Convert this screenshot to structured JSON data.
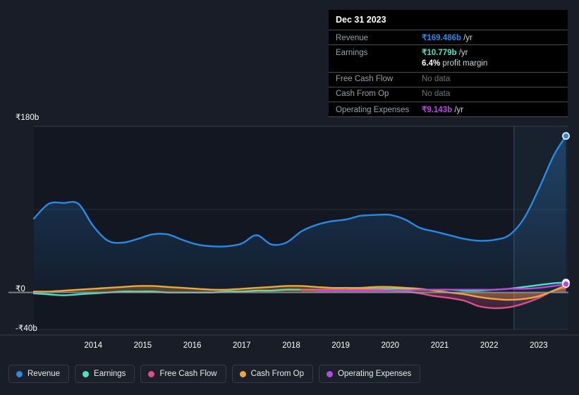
{
  "background": "#181d27",
  "tooltip": {
    "date": "Dec 31 2023",
    "rows": [
      {
        "label": "Revenue",
        "amount": "₹169.486b",
        "unit": " /yr",
        "color": "#2b8ae0",
        "no_data": false
      },
      {
        "label": "Earnings",
        "amount": "₹10.779b",
        "unit": " /yr",
        "color": "#4fe0c0",
        "no_data": false
      },
      {
        "label": "Free Cash Flow",
        "amount": "No data",
        "unit": "",
        "color": "#6d7278",
        "no_data": true
      },
      {
        "label": "Cash From Op",
        "amount": "No data",
        "unit": "",
        "color": "#6d7278",
        "no_data": true
      },
      {
        "label": "Operating Expenses",
        "amount": "₹9.143b",
        "unit": " /yr",
        "color": "#b44ae0",
        "no_data": false
      }
    ],
    "profit_margin_value": "6.4%",
    "profit_margin_label": " profit margin"
  },
  "legend": {
    "items": [
      {
        "label": "Revenue",
        "color": "#2b8ae0"
      },
      {
        "label": "Earnings",
        "color": "#4fe0c0"
      },
      {
        "label": "Free Cash Flow",
        "color": "#d9508a"
      },
      {
        "label": "Cash From Op",
        "color": "#e8a93f"
      },
      {
        "label": "Operating Expenses",
        "color": "#b44ae0"
      }
    ]
  },
  "chart_data": {
    "type": "area",
    "title": "",
    "xlabel": "",
    "ylabel": "",
    "currency": "₹",
    "units": "billions (b) per year",
    "ylim": [
      -40,
      180
    ],
    "y_ticks": [
      {
        "value": 180,
        "label": "₹180b"
      },
      {
        "value": 0,
        "label": "₹0"
      },
      {
        "value": -40,
        "label": "-₹40b"
      }
    ],
    "gridlines": [
      180,
      90,
      0,
      -40
    ],
    "grid": true,
    "legend_position": "bottom",
    "x_ticks": [
      "2014",
      "2015",
      "2016",
      "2017",
      "2018",
      "2019",
      "2020",
      "2021",
      "2022",
      "2023"
    ],
    "x_range": [
      2013.3,
      2024.1
    ],
    "forecast_divider_x": 2023.0,
    "x": [
      2013.3,
      2013.6,
      2013.9,
      2014.2,
      2014.5,
      2014.8,
      2015.1,
      2015.4,
      2015.7,
      2016.0,
      2016.3,
      2016.6,
      2016.9,
      2017.2,
      2017.5,
      2017.8,
      2018.1,
      2018.4,
      2018.7,
      2019.0,
      2019.3,
      2019.6,
      2019.9,
      2020.2,
      2020.5,
      2020.8,
      2021.1,
      2021.4,
      2021.7,
      2022.0,
      2022.3,
      2022.6,
      2022.9,
      2023.2,
      2023.5,
      2023.8,
      2024.05
    ],
    "series": [
      {
        "name": "Revenue",
        "color": "#2b8ae0",
        "filled": true,
        "end_value": 169.486,
        "values": [
          80,
          96,
          97,
          96,
          72,
          56,
          54,
          58,
          63,
          63,
          57,
          52,
          50,
          50,
          53,
          62,
          52,
          54,
          66,
          73,
          77,
          79,
          83,
          84,
          84,
          79,
          70,
          66,
          62,
          58,
          56,
          57,
          62,
          80,
          112,
          148,
          169.486
        ]
      },
      {
        "name": "Earnings",
        "color": "#4fe0c0",
        "filled": false,
        "end_value": 10.779,
        "values": [
          -1,
          -2,
          -3,
          -2,
          -1,
          0,
          1,
          1,
          1,
          0,
          0,
          0,
          0,
          1,
          1,
          2,
          2,
          3,
          3,
          3,
          3,
          3,
          4,
          4,
          4,
          4,
          3,
          3,
          3,
          2,
          2,
          3,
          4,
          6,
          8,
          10,
          10.779
        ]
      },
      {
        "name": "Free Cash Flow",
        "color": "#d9508a",
        "filled": true,
        "end_value": null,
        "values": [
          null,
          null,
          null,
          null,
          null,
          null,
          null,
          null,
          null,
          null,
          null,
          null,
          null,
          null,
          null,
          null,
          null,
          null,
          3,
          3,
          3,
          3,
          3,
          3,
          2,
          1,
          -1,
          -4,
          -6,
          -9,
          -15,
          -17,
          -16,
          -12,
          -6,
          2,
          5
        ]
      },
      {
        "name": "Cash From Op",
        "color": "#e8a93f",
        "filled": true,
        "end_value": null,
        "values": [
          1,
          1,
          2,
          3,
          4,
          5,
          6,
          7,
          7,
          6,
          5,
          4,
          3,
          3,
          4,
          5,
          6,
          7,
          7,
          6,
          5,
          5,
          5,
          6,
          6,
          5,
          4,
          2,
          0,
          -2,
          -5,
          -7,
          -8,
          -7,
          -4,
          2,
          8
        ]
      },
      {
        "name": "Operating Expenses",
        "color": "#b44ae0",
        "filled": false,
        "end_value": 9.143,
        "values": [
          null,
          null,
          null,
          null,
          null,
          null,
          null,
          null,
          null,
          null,
          null,
          null,
          null,
          null,
          null,
          null,
          null,
          null,
          null,
          2,
          2,
          2,
          2,
          2,
          2,
          2,
          3,
          3,
          3,
          3,
          3,
          3,
          4,
          4,
          5,
          7,
          9.143
        ]
      }
    ]
  }
}
